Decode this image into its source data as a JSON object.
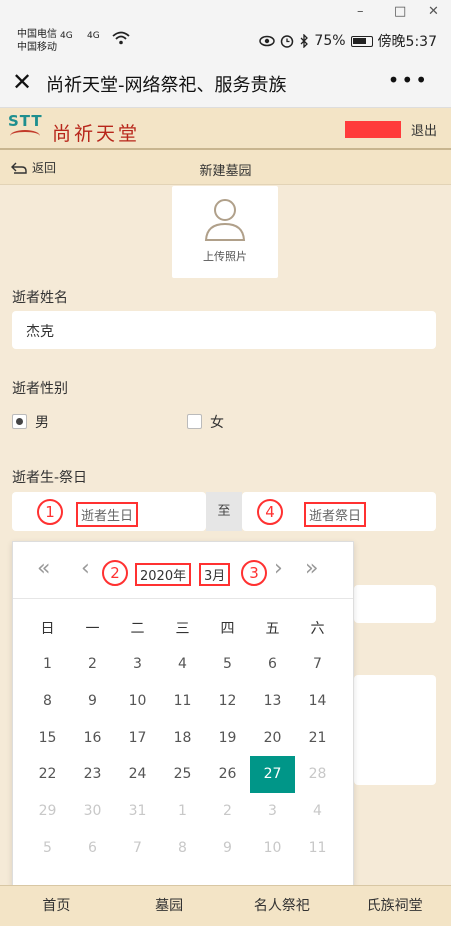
{
  "status": {
    "carrier1": "中国电信",
    "carrier2": "中国移动",
    "sig1": "4G",
    "sig2": "4G",
    "battery": "75%",
    "time": "傍晚5:37"
  },
  "window": {
    "minimize": "–",
    "maximize": "□",
    "close": "✕"
  },
  "titlebar": {
    "title": "尚祈天堂-网络祭祀、服务贵族",
    "close_icon": "✕",
    "more_icon": "•••"
  },
  "site": {
    "logo_text": "STT",
    "logo_cn": "尚祈天堂",
    "logout": "退出",
    "user_color": "#ff3b3b"
  },
  "subheader": {
    "back": "返回",
    "title": "新建墓园"
  },
  "photo": {
    "label": "上传照片"
  },
  "form": {
    "name_label": "逝者姓名",
    "name_value": "杰克",
    "gender_label": "逝者性别",
    "male": "男",
    "female": "女",
    "date_label": "逝者生-祭日",
    "birth_placeholder": "逝者生日",
    "sep": "至",
    "death_placeholder": "逝者祭日"
  },
  "annotations": [
    "1",
    "2",
    "3",
    "4"
  ],
  "calendar": {
    "prev_year": "«",
    "prev_month": "‹",
    "next_month": "›",
    "next_year": "»",
    "year": "2020年",
    "month": "3月",
    "weekdays": [
      "日",
      "一",
      "二",
      "三",
      "四",
      "五",
      "六"
    ],
    "days": [
      {
        "d": "1",
        "t": "cur"
      },
      {
        "d": "2",
        "t": "cur"
      },
      {
        "d": "3",
        "t": "cur"
      },
      {
        "d": "4",
        "t": "cur"
      },
      {
        "d": "5",
        "t": "cur"
      },
      {
        "d": "6",
        "t": "cur"
      },
      {
        "d": "7",
        "t": "cur"
      },
      {
        "d": "8",
        "t": "cur"
      },
      {
        "d": "9",
        "t": "cur"
      },
      {
        "d": "10",
        "t": "cur"
      },
      {
        "d": "11",
        "t": "cur"
      },
      {
        "d": "12",
        "t": "cur"
      },
      {
        "d": "13",
        "t": "cur"
      },
      {
        "d": "14",
        "t": "cur"
      },
      {
        "d": "15",
        "t": "cur"
      },
      {
        "d": "16",
        "t": "cur"
      },
      {
        "d": "17",
        "t": "cur"
      },
      {
        "d": "18",
        "t": "cur"
      },
      {
        "d": "19",
        "t": "cur"
      },
      {
        "d": "20",
        "t": "cur"
      },
      {
        "d": "21",
        "t": "cur"
      },
      {
        "d": "22",
        "t": "cur"
      },
      {
        "d": "23",
        "t": "cur"
      },
      {
        "d": "24",
        "t": "cur"
      },
      {
        "d": "25",
        "t": "cur"
      },
      {
        "d": "26",
        "t": "cur"
      },
      {
        "d": "27",
        "t": "sel"
      },
      {
        "d": "28",
        "t": "other"
      },
      {
        "d": "29",
        "t": "other"
      },
      {
        "d": "30",
        "t": "other"
      },
      {
        "d": "31",
        "t": "other"
      },
      {
        "d": "1",
        "t": "other"
      },
      {
        "d": "2",
        "t": "other"
      },
      {
        "d": "3",
        "t": "other"
      },
      {
        "d": "4",
        "t": "other"
      },
      {
        "d": "5",
        "t": "other"
      },
      {
        "d": "6",
        "t": "other"
      },
      {
        "d": "7",
        "t": "other"
      },
      {
        "d": "8",
        "t": "other"
      },
      {
        "d": "9",
        "t": "other"
      },
      {
        "d": "10",
        "t": "other"
      },
      {
        "d": "11",
        "t": "other"
      }
    ],
    "selected_color": "#009688"
  },
  "bottom_nav": [
    "首页",
    "墓园",
    "名人祭祀",
    "氏族祠堂"
  ]
}
